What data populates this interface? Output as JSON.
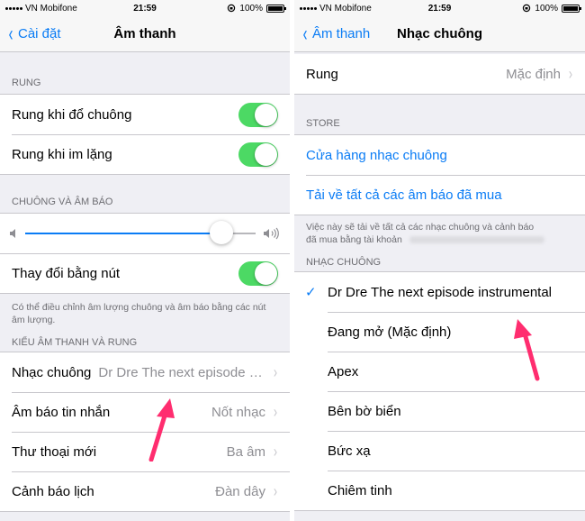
{
  "left": {
    "status": {
      "carrier": "VN Mobifone",
      "time": "21:59",
      "battery": "100%"
    },
    "nav": {
      "back_label": "Cài đặt",
      "title": "Âm thanh"
    },
    "rung": {
      "header": "RUNG",
      "rows": [
        {
          "label": "Rung khi đổ chuông",
          "on": true
        },
        {
          "label": "Rung khi im lặng",
          "on": true
        }
      ]
    },
    "chuong": {
      "header": "CHUÔNG VÀ ÂM BÁO",
      "volume_level": 0.85,
      "toggle_label": "Thay đổi bằng nút",
      "note": "Có thể điều chỉnh âm lượng chuông và âm báo bằng các nút âm lượng."
    },
    "kieu": {
      "header": "KIỂU ÂM THANH VÀ RUNG",
      "rows": [
        {
          "label": "Nhạc chuông",
          "value": "Dr Dre The next episode in..."
        },
        {
          "label": "Âm báo tin nhắn",
          "value": "Nốt nhạc"
        },
        {
          "label": "Thư thoại mới",
          "value": "Ba âm"
        },
        {
          "label": "Cảnh báo lịch",
          "value": "Đàn dây"
        }
      ]
    }
  },
  "right": {
    "status": {
      "carrier": "VN Mobifone",
      "time": "21:59",
      "battery": "100%"
    },
    "nav": {
      "back_label": "Âm thanh",
      "title": "Nhạc chuông"
    },
    "rung_row": {
      "label": "Rung",
      "value": "Mặc định"
    },
    "store": {
      "header": "STORE",
      "links": [
        "Cửa hàng nhạc chuông",
        "Tải về tất cả các âm báo đã mua"
      ],
      "note_line1": "Việc này sẽ tải về tất cả các nhạc chuông và cảnh báo",
      "note_line2": "đã mua bằng tài khoản"
    },
    "nhac": {
      "header": "NHẠC CHUÔNG",
      "items": [
        {
          "label": "Dr Dre The next episode instrumental",
          "selected": true
        },
        {
          "label": "Đang mở (Mặc định)",
          "selected": false
        },
        {
          "label": "Apex",
          "selected": false
        },
        {
          "label": "Bên bờ biển",
          "selected": false
        },
        {
          "label": "Bức xạ",
          "selected": false
        },
        {
          "label": "Chiêm tinh",
          "selected": false
        }
      ],
      "checkmark": "✓"
    }
  },
  "colors": {
    "accent": "#0a7cf5",
    "toggle_on": "#4cd964",
    "arrow": "#ff2d6f"
  },
  "icons": [
    "signal-icon",
    "lock-rotation-icon",
    "battery-icon",
    "back-chevron-icon",
    "chevron-right-icon",
    "speaker-low-icon",
    "speaker-high-icon",
    "checkmark-icon",
    "pointer-arrow"
  ]
}
